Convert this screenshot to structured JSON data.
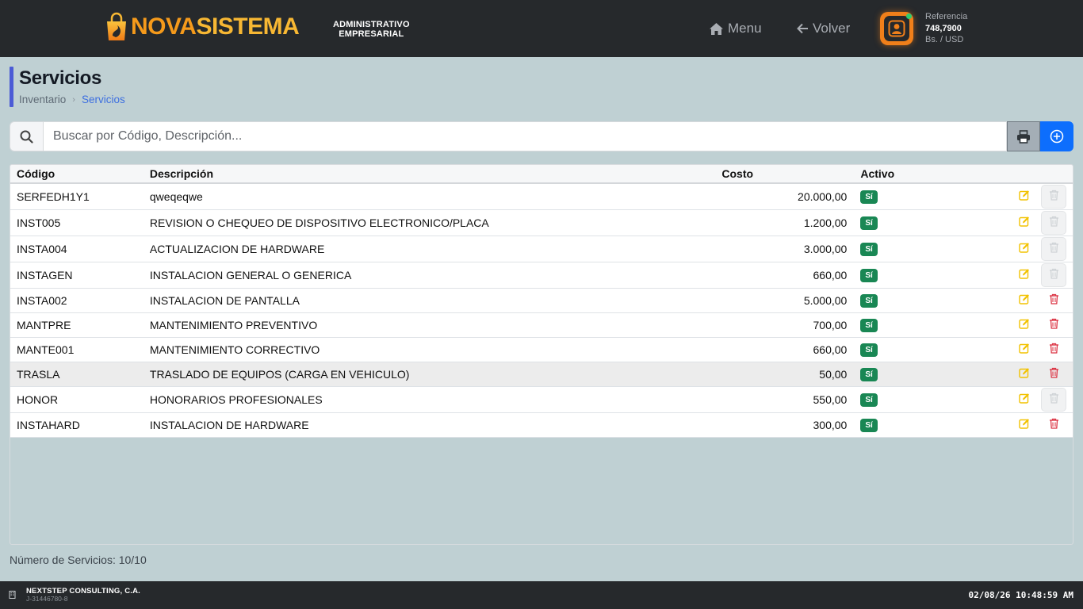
{
  "header": {
    "logo_part1": "NOVA",
    "logo_part2": "SISTEMA",
    "subtitle_line1": "ADMINISTRATIVO",
    "subtitle_line2": "EMPRESARIAL",
    "nav_menu": "Menu",
    "nav_back": "Volver",
    "reference_label": "Referencia",
    "reference_value": "748,7900",
    "reference_unit": "Bs. / USD"
  },
  "page": {
    "title": "Servicios",
    "breadcrumb": [
      "Inventario",
      "Servicios"
    ]
  },
  "search": {
    "placeholder": "Buscar por Código, Descripción..."
  },
  "table": {
    "headers": [
      "Código",
      "Descripción",
      "Costo",
      "Activo"
    ],
    "rows": [
      {
        "code": "SERFEDH1Y1",
        "desc": "qweqeqwe",
        "cost": "20.000,00",
        "active": "Sí",
        "delete_enabled": false
      },
      {
        "code": "INST005",
        "desc": "REVISION O CHEQUEO DE DISPOSITIVO ELECTRONICO/PLACA",
        "cost": "1.200,00",
        "active": "Sí",
        "delete_enabled": false
      },
      {
        "code": "INSTA004",
        "desc": "ACTUALIZACION DE HARDWARE",
        "cost": "3.000,00",
        "active": "Sí",
        "delete_enabled": false
      },
      {
        "code": "INSTAGEN",
        "desc": "INSTALACION GENERAL O GENERICA",
        "cost": "660,00",
        "active": "Sí",
        "delete_enabled": false
      },
      {
        "code": "INSTA002",
        "desc": "INSTALACION DE PANTALLA",
        "cost": "5.000,00",
        "active": "Sí",
        "delete_enabled": true
      },
      {
        "code": "MANTPRE",
        "desc": "MANTENIMIENTO PREVENTIVO",
        "cost": "700,00",
        "active": "Sí",
        "delete_enabled": true
      },
      {
        "code": "MANTE001",
        "desc": "MANTENIMIENTO CORRECTIVO",
        "cost": "660,00",
        "active": "Sí",
        "delete_enabled": true
      },
      {
        "code": "TRASLA",
        "desc": "TRASLADO DE EQUIPOS (CARGA EN VEHICULO)",
        "cost": "50,00",
        "active": "Sí",
        "delete_enabled": true,
        "highlighted": true
      },
      {
        "code": "HONOR",
        "desc": "HONORARIOS PROFESIONALES",
        "cost": "550,00",
        "active": "Sí",
        "delete_enabled": false
      },
      {
        "code": "INSTAHARD",
        "desc": "INSTALACION DE HARDWARE",
        "cost": "300,00",
        "active": "Sí",
        "delete_enabled": true
      }
    ]
  },
  "footer": {
    "count_text": "Número de Servicios: 10/10"
  },
  "statusbar": {
    "company": "NEXTSTEP CONSULTING, C.A.",
    "rif": "J-31446780-8",
    "datetime": "02/08/26 10:48:59 AM"
  },
  "colors": {
    "header_bg": "#26292c",
    "page_bg": "#bfd0d3",
    "accent_blue": "#0d6efd",
    "badge_green": "#198754",
    "logo_orange": "#f59a1b",
    "edit_yellow": "#f2c200",
    "delete_red": "#dc3545"
  },
  "icons": {
    "menu": "home-icon",
    "back": "arrow-left-icon",
    "user": "user-icon",
    "search": "search-icon",
    "print": "printer-icon",
    "add": "plus-circle-icon",
    "edit": "pencil-square-icon",
    "delete": "trash-icon",
    "company": "building-icon"
  }
}
